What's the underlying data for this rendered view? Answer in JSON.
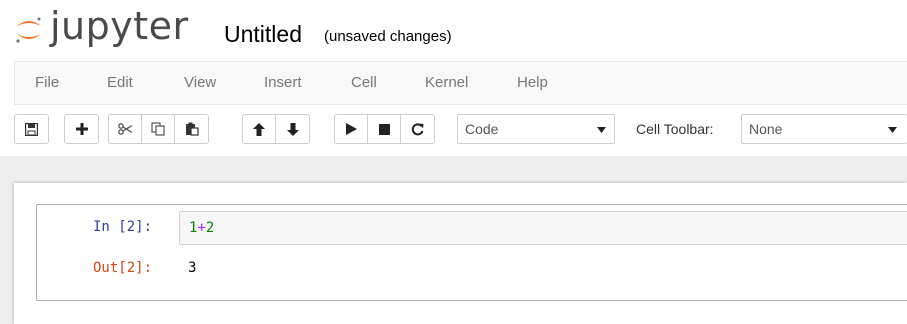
{
  "header": {
    "logo_text": "jupyter",
    "notebook_title": "Untitled",
    "save_status": "(unsaved changes)"
  },
  "menubar": {
    "items": [
      "File",
      "Edit",
      "View",
      "Insert",
      "Cell",
      "Kernel",
      "Help"
    ]
  },
  "toolbar": {
    "buttons": [
      {
        "name": "save-icon"
      },
      {
        "name": "plus-icon"
      },
      {
        "name": "cut-icon"
      },
      {
        "name": "copy-icon"
      },
      {
        "name": "paste-icon"
      },
      {
        "name": "arrow-up-icon"
      },
      {
        "name": "arrow-down-icon"
      },
      {
        "name": "play-icon"
      },
      {
        "name": "stop-icon"
      },
      {
        "name": "restart-icon"
      }
    ],
    "cell_type_value": "Code",
    "cell_toolbar_label": "Cell Toolbar:",
    "cell_toolbar_value": "None"
  },
  "cell": {
    "in_prompt": "In [2]:",
    "code_left": "1",
    "code_op": "+",
    "code_right": "2",
    "out_prompt": "Out[2]:",
    "output": "3"
  },
  "colors": {
    "in_prompt": "#303f9f",
    "out_prompt": "#d84315",
    "logo_orange": "#f37726",
    "number": "#008800",
    "operator": "#aa22ff"
  }
}
